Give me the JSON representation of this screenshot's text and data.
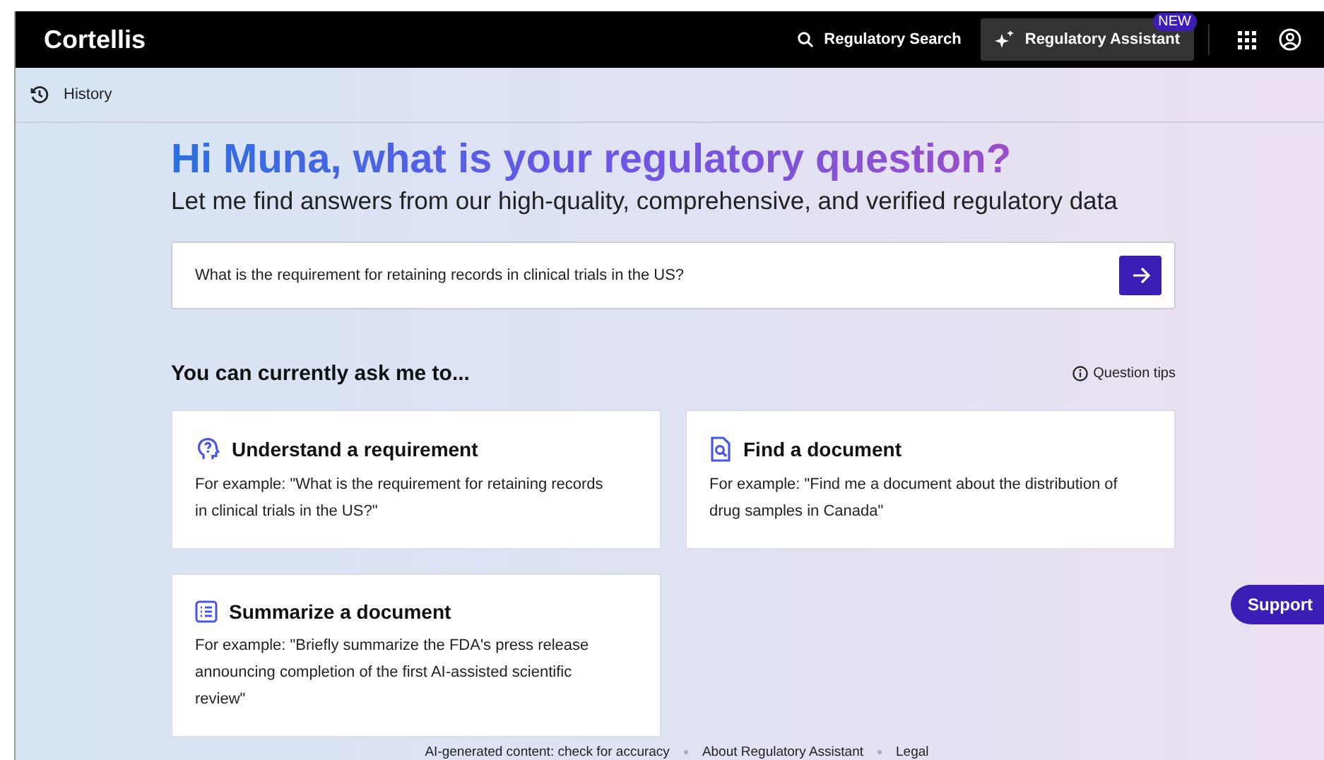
{
  "header": {
    "logo": "Cortellis",
    "nav": [
      {
        "kind": "search",
        "label": "Regulatory Search",
        "selected": false
      },
      {
        "kind": "assistant",
        "label": "Regulatory Assistant",
        "selected": true,
        "badge": "NEW"
      }
    ]
  },
  "history": {
    "label": "History"
  },
  "greeting": {
    "title": "Hi Muna, what is your regulatory question?",
    "subtitle": "Let me find answers from our high-quality, comprehensive, and verified regulatory data"
  },
  "question": {
    "value": "What is the requirement for retaining records in clinical trials in the US?"
  },
  "capabilities": {
    "title": "You can currently ask me to...",
    "tips": "Question tips",
    "cards": [
      {
        "kind": "question",
        "title": "Understand a requirement",
        "example": "For example: \"What is the requirement for retaining records in clinical trials in the US?\""
      },
      {
        "kind": "find",
        "title": "Find a document",
        "example": "For example: \"Find me a document about the distribution of drug samples in Canada\""
      },
      {
        "kind": "summarize",
        "title": "Summarize a document",
        "example": "For example: \"Briefly summarize the FDA's press release announcing completion of the first AI-assisted scientific review\""
      }
    ]
  },
  "footer": [
    "AI-generated content: check for accuracy",
    "About Regulatory Assistant",
    "Legal"
  ],
  "support": "Support"
}
